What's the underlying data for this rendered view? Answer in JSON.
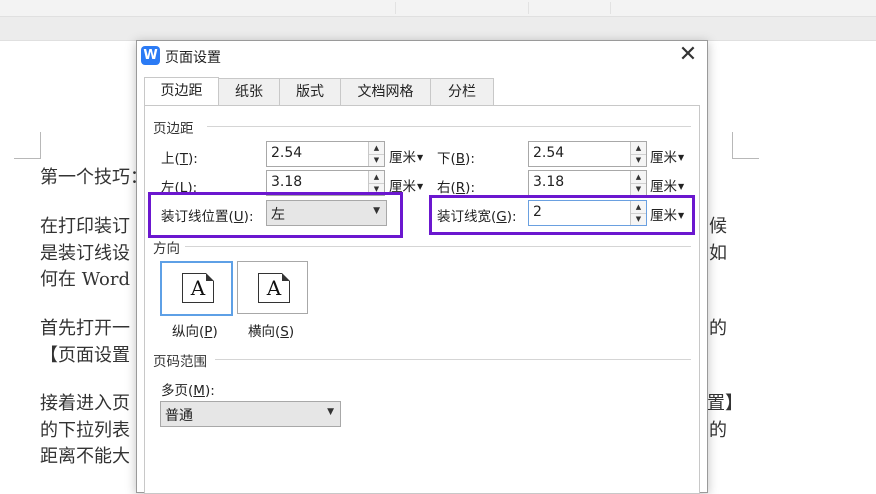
{
  "dialog": {
    "title": "页面设置",
    "app_icon": "W",
    "close": "✕",
    "tabs": [
      "页边距",
      "纸张",
      "版式",
      "文档网格",
      "分栏"
    ]
  },
  "margins": {
    "section": "页边距",
    "top_label": "上(",
    "top_key": "T",
    "top_end": "):",
    "top_value": "2.54",
    "bottom_label": "下(",
    "bottom_key": "B",
    "bottom_end": "):",
    "bottom_value": "2.54",
    "left_label": "左(",
    "left_key": "L",
    "left_end": "):",
    "left_value": "3.18",
    "right_label": "右(",
    "right_key": "R",
    "right_end": "):",
    "right_value": "3.18",
    "gutter_pos_label": "装订线位置(",
    "gutter_pos_key": "U",
    "gutter_pos_end": "):",
    "gutter_pos_value": "左",
    "gutter_width_label": "装订线宽(",
    "gutter_width_key": "G",
    "gutter_width_end": "):",
    "gutter_width_value": "2",
    "unit": "厘米"
  },
  "orientation": {
    "section": "方向",
    "portrait": "纵向(",
    "portrait_key": "P",
    "portrait_end": ")",
    "landscape": "横向(",
    "landscape_key": "S",
    "landscape_end": ")",
    "icon_letter": "A"
  },
  "page_range": {
    "section": "页码范围",
    "multi_label": "多页(",
    "multi_key": "M",
    "multi_end": "):",
    "multi_value": "普通"
  },
  "document": {
    "lines": [
      {
        "left": "第一个技巧：",
        "right": ""
      },
      {
        "left": "在打印装订",
        "right": "候"
      },
      {
        "left": "是装订线设",
        "right": "如"
      },
      {
        "left": "何在 Word",
        "right": ""
      },
      {
        "left": "首先打开一",
        "right": "的"
      },
      {
        "left": "【页面设置",
        "right": ""
      },
      {
        "left": "接着进入页",
        "right": "置】"
      },
      {
        "left": "的下拉列表",
        "right": "的"
      },
      {
        "left": "距离不能大",
        "right": ""
      }
    ]
  },
  "colors": {
    "highlight": "#6b17cf",
    "accent": "#2b7bf5",
    "selected": "#5ea0e6"
  }
}
